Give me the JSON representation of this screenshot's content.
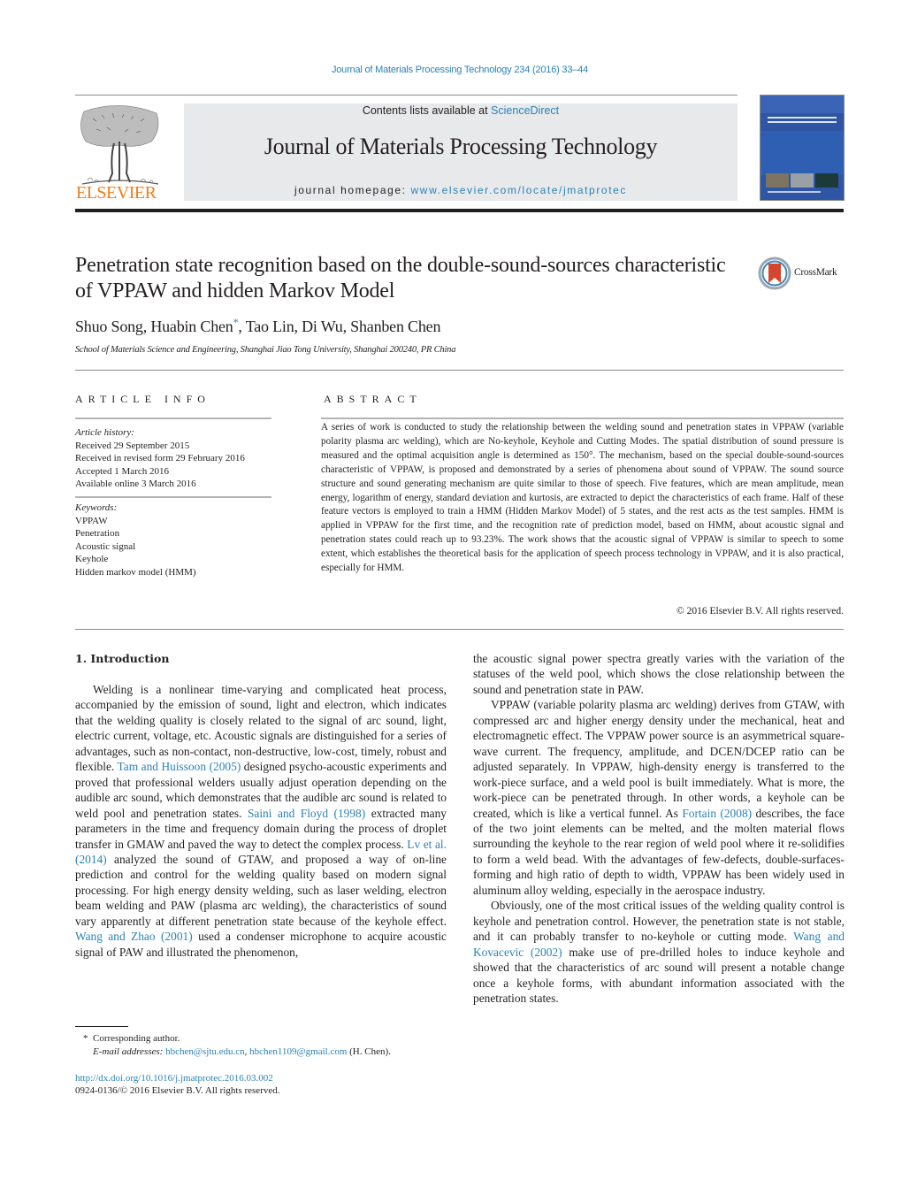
{
  "header": {
    "journal_reference": "Journal of Materials Processing Technology 234 (2016) 33–44",
    "contents_prefix": "Contents lists available at ",
    "contents_link": "ScienceDirect",
    "journal_title": "Journal of Materials Processing Technology",
    "homepage_prefix": "journal homepage: ",
    "homepage_url": "www.elsevier.com/locate/jmatprotec",
    "publisher_logo_text": "ELSEVIER",
    "crossmark_label": "CrossMark"
  },
  "article": {
    "title": "Penetration state recognition based on the double-sound-sources characteristic of VPPAW and hidden Markov Model",
    "authors_before": "Shuo Song, Huabin Chen",
    "author_marker": "*",
    "authors_after": ", Tao Lin, Di Wu, Shanben Chen",
    "affiliation": "School of Materials Science and Engineering, Shanghai Jiao Tong University, Shanghai 200240, PR China"
  },
  "article_info": {
    "heading": "ARTICLE INFO",
    "history_label": "Article history:",
    "history": [
      "Received 29 September 2015",
      "Received in revised form 29 February 2016",
      "Accepted 1 March 2016",
      "Available online 3 March 2016"
    ],
    "keywords_label": "Keywords:",
    "keywords": [
      "VPPAW",
      "Penetration",
      "Acoustic signal",
      "Keyhole",
      "Hidden markov model (HMM)"
    ]
  },
  "abstract": {
    "heading": "ABSTRACT",
    "text": "A series of work is conducted to study the relationship between the welding sound and penetration states in VPPAW (variable polarity plasma arc welding), which are No-keyhole, Keyhole and Cutting Modes. The spatial distribution of sound pressure is measured and the optimal acquisition angle is determined as 150°. The mechanism, based on the special double-sound-sources characteristic of VPPAW, is proposed and demonstrated by a series of phenomena about sound of VPPAW. The sound source structure and sound generating mechanism are quite similar to those of speech. Five features, which are mean amplitude, mean energy, logarithm of energy, standard deviation and kurtosis, are extracted to depict the characteristics of each frame. Half of these feature vectors is employed to train a HMM (Hidden Markov Model) of 5 states, and the rest acts as the test samples. HMM is applied in VPPAW for the first time, and the recognition rate of prediction model, based on HMM, about acoustic signal and penetration states could reach up to 93.23%. The work shows that the acoustic signal of VPPAW is similar to speech to some extent, which establishes the theoretical basis for the application of speech process technology in VPPAW, and it is also practical, especially for HMM.",
    "copyright": "© 2016 Elsevier B.V. All rights reserved."
  },
  "introduction": {
    "heading": "1.  Introduction",
    "left_column": {
      "p1_a": "Welding is a nonlinear time-varying and complicated heat process, accompanied by the emission of sound, light and electron, which indicates that the welding quality is closely related to the signal of arc sound, light, electric current, voltage, etc. Acoustic signals are distinguished for a series of advantages, such as non-contact, non-destructive, low-cost, timely, robust and flexible. ",
      "cite1": "Tam and Huissoon (2005)",
      "p1_b": " designed psycho-acoustic experiments and proved that professional welders usually adjust operation depending on the audible arc sound, which demonstrates that the audible arc sound is related to weld pool and penetration states. ",
      "cite2": "Saini and Floyd (1998)",
      "p1_c": " extracted many parameters in the time and frequency domain during the process of droplet transfer in GMAW and paved the way to detect the complex process. ",
      "cite3": "Lv et al. (2014)",
      "p1_d": " analyzed the sound of GTAW, and proposed a way of on-line prediction and control for the welding quality based on modern signal processing. For high energy density welding, such as laser welding, electron beam welding and PAW (plasma arc welding), the characteristics of sound vary apparently at different penetration state because of the keyhole effect. ",
      "cite4": "Wang and Zhao (2001)",
      "p1_e": " used a condenser microphone to acquire acoustic signal of PAW and illustrated the phenomenon,"
    },
    "right_column": {
      "p1_cont": "the acoustic signal power spectra greatly varies with the variation of the statuses of the weld pool, which shows the close relationship between the sound and penetration state in PAW.",
      "p2_a": "VPPAW (variable polarity plasma arc welding) derives from GTAW, with compressed arc and higher energy density under the mechanical, heat and electromagnetic effect. The VPPAW power source is an asymmetrical square-wave current. The frequency, amplitude, and DCEN/DCEP ratio can be adjusted separately. In VPPAW, high-density energy is transferred to the work-piece surface, and a weld pool is built immediately. What is more, the work-piece can be penetrated through. In other words, a keyhole can be created, which is like a vertical funnel. As ",
      "cite5": "Fortain (2008)",
      "p2_b": " describes, the face of the two joint elements can be melted, and the molten material flows surrounding the keyhole to the rear region of weld pool where it re-solidifies to form a weld bead. With the advantages of few-defects, double-surfaces-forming and high ratio of depth to width, VPPAW has been widely used in aluminum alloy welding, especially in the aerospace industry.",
      "p3_a": "Obviously, one of the most critical issues of the welding quality control is keyhole and penetration control. However, the penetration state is not stable, and it can probably transfer to no-keyhole or cutting mode. ",
      "cite6": "Wang and Kovacevic (2002)",
      "p3_b": " make use of pre-drilled holes to induce keyhole and showed that the characteristics of arc sound will present a notable change once a keyhole forms, with abundant information associated with the penetration states."
    }
  },
  "footnotes": {
    "marker": "*",
    "corresponding": "Corresponding author.",
    "email_label": "E-mail addresses:",
    "email1": "hbchen@sjtu.edu.cn",
    "email_sep": ", ",
    "email2": "hbchen1109@gmail.com",
    "email_suffix": " (H. Chen).",
    "doi": "http://dx.doi.org/10.1016/j.jmatprotec.2016.03.002",
    "issn": "0924-0136/© 2016 Elsevier B.V. All rights reserved."
  },
  "colors": {
    "link": "#2a82b5",
    "elsevier_orange": "#f07c19",
    "masthead_gray": "#e8e9eb",
    "cover_blue": "#2f55a5"
  }
}
